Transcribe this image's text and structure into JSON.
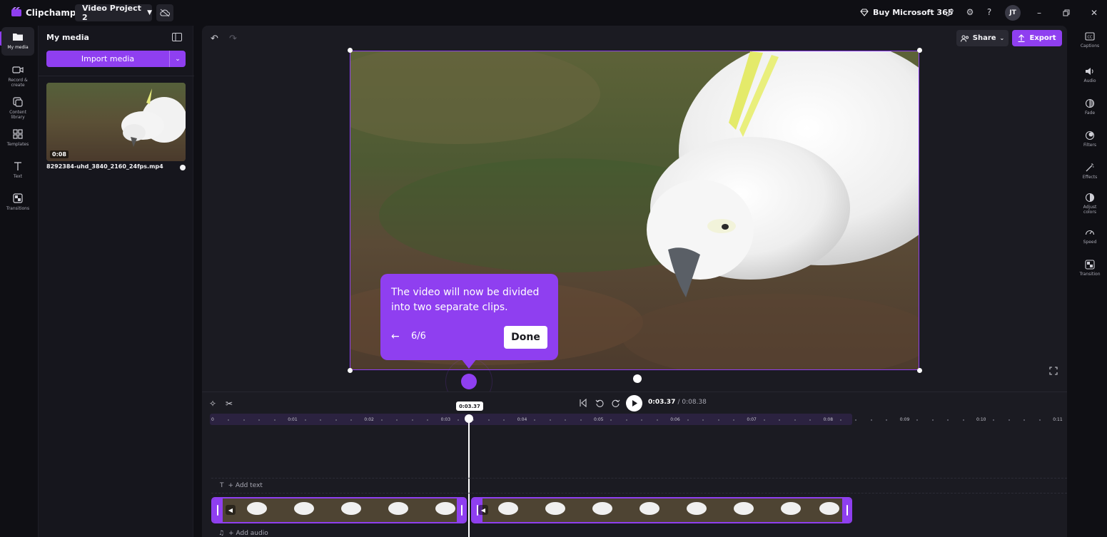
{
  "app": {
    "name": "Clipchamp",
    "project_name": "Video Project 2",
    "buy_label": "Buy Microsoft 365",
    "user_initials": "JT",
    "accent_color": "#8f3ff0"
  },
  "left_nav": {
    "items": [
      {
        "label": "My media",
        "icon": "folder-icon",
        "active": true
      },
      {
        "label": "Record & create",
        "icon": "camera-icon",
        "active": false
      },
      {
        "label": "Content library",
        "icon": "library-icon",
        "active": false
      },
      {
        "label": "Templates",
        "icon": "templates-icon",
        "active": false
      },
      {
        "label": "Text",
        "icon": "text-icon",
        "active": false
      },
      {
        "label": "Transitions",
        "icon": "transitions-icon",
        "active": false
      }
    ]
  },
  "media_panel": {
    "title": "My media",
    "import_label": "Import media",
    "asset": {
      "duration": "0:08",
      "filename": "8292384-uhd_3840_2160_24fps.mp4"
    }
  },
  "toolbar": {
    "share_label": "Share",
    "export_label": "Export"
  },
  "tooltip": {
    "text": "The video will now be divided into two separate clips.",
    "step": "6/6",
    "done_label": "Done"
  },
  "right_panel": {
    "items": [
      {
        "label": "Captions",
        "icon": "captions-icon"
      },
      {
        "label": "Audio",
        "icon": "speaker-icon"
      },
      {
        "label": "Fade",
        "icon": "fade-icon"
      },
      {
        "label": "Filters",
        "icon": "filters-icon"
      },
      {
        "label": "Effects",
        "icon": "effects-icon"
      },
      {
        "label": "Adjust colors",
        "icon": "adjust-colors-icon"
      },
      {
        "label": "Speed",
        "icon": "speed-icon"
      },
      {
        "label": "Transition",
        "icon": "transition-icon"
      }
    ]
  },
  "timeline": {
    "current_time": "0:03.37",
    "total_time": "/ 0:08.38",
    "playhead_label": "0:03.37",
    "ruler_labels": [
      "0",
      "0:01",
      "0:02",
      "0:03",
      "0:04",
      "0:05",
      "0:06",
      "0:07",
      "0:08",
      "0:09",
      "0:10",
      "0:11"
    ],
    "add_text_label": "+ Add text",
    "add_audio_label": "+ Add audio"
  }
}
